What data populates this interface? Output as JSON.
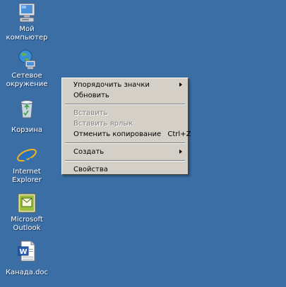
{
  "desktop": {
    "background_color": "#3A6EA5",
    "icons": [
      {
        "icon": "my-computer-icon",
        "lines": [
          "Мой",
          "компьютер"
        ]
      },
      {
        "icon": "network-places-icon",
        "lines": [
          "Сетевое",
          "окружение"
        ]
      },
      {
        "icon": "recycle-bin-icon",
        "lines": [
          "Корзина"
        ]
      },
      {
        "icon": "internet-explorer-icon",
        "lines": [
          "Internet",
          "Explorer"
        ]
      },
      {
        "icon": "outlook-icon",
        "lines": [
          "Microsoft",
          "Outlook"
        ]
      },
      {
        "icon": "word-document-icon",
        "lines": [
          "Канада.doc"
        ]
      }
    ]
  },
  "context_menu": {
    "background_color": "#D4D0C8",
    "arrange_icons": "Упорядочить значки",
    "refresh": "Обновить",
    "paste": "Вставить",
    "paste_shortcut": "Вставить ярлык",
    "undo_copy": "Отменить копирование",
    "undo_copy_shortcut": "Ctrl+Z",
    "new": "Создать",
    "properties": "Свойства"
  }
}
